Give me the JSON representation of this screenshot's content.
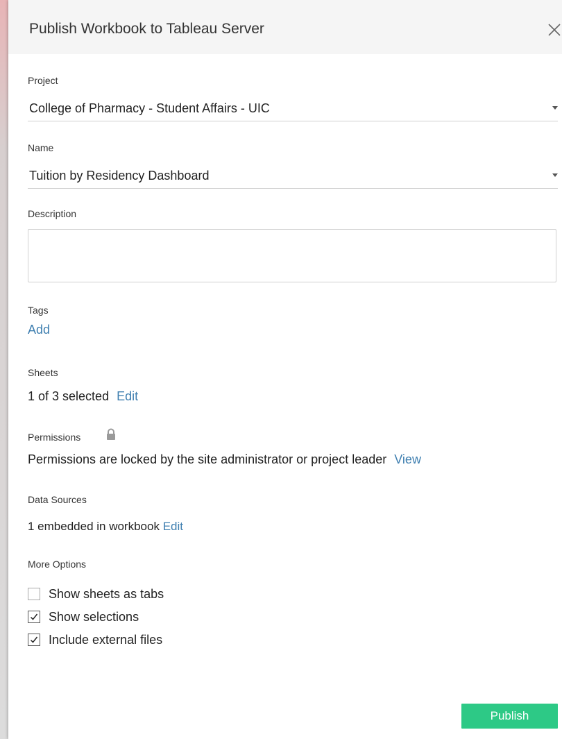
{
  "dialog": {
    "title": "Publish Workbook to Tableau Server"
  },
  "project": {
    "label": "Project",
    "value": "College of Pharmacy - Student Affairs - UIC"
  },
  "name": {
    "label": "Name",
    "value": "Tuition by Residency Dashboard"
  },
  "description": {
    "label": "Description",
    "value": ""
  },
  "tags": {
    "label": "Tags",
    "add_link": "Add"
  },
  "sheets": {
    "label": "Sheets",
    "summary": "1 of 3 selected",
    "edit_link": "Edit"
  },
  "permissions": {
    "label": "Permissions",
    "icon": "lock-icon",
    "message": "Permissions are locked by the site administrator or project leader",
    "view_link": "View"
  },
  "data_sources": {
    "label": "Data Sources",
    "summary": "1 embedded in workbook",
    "edit_link": "Edit"
  },
  "more_options": {
    "label": "More Options",
    "options": [
      {
        "label": "Show sheets as tabs",
        "checked": false
      },
      {
        "label": "Show selections",
        "checked": true
      },
      {
        "label": "Include external files",
        "checked": true
      }
    ]
  },
  "actions": {
    "publish_label": "Publish"
  },
  "colors": {
    "accent_link": "#3f7fb0",
    "publish_button": "#2dc986",
    "header_bg": "#f5f5f5"
  }
}
